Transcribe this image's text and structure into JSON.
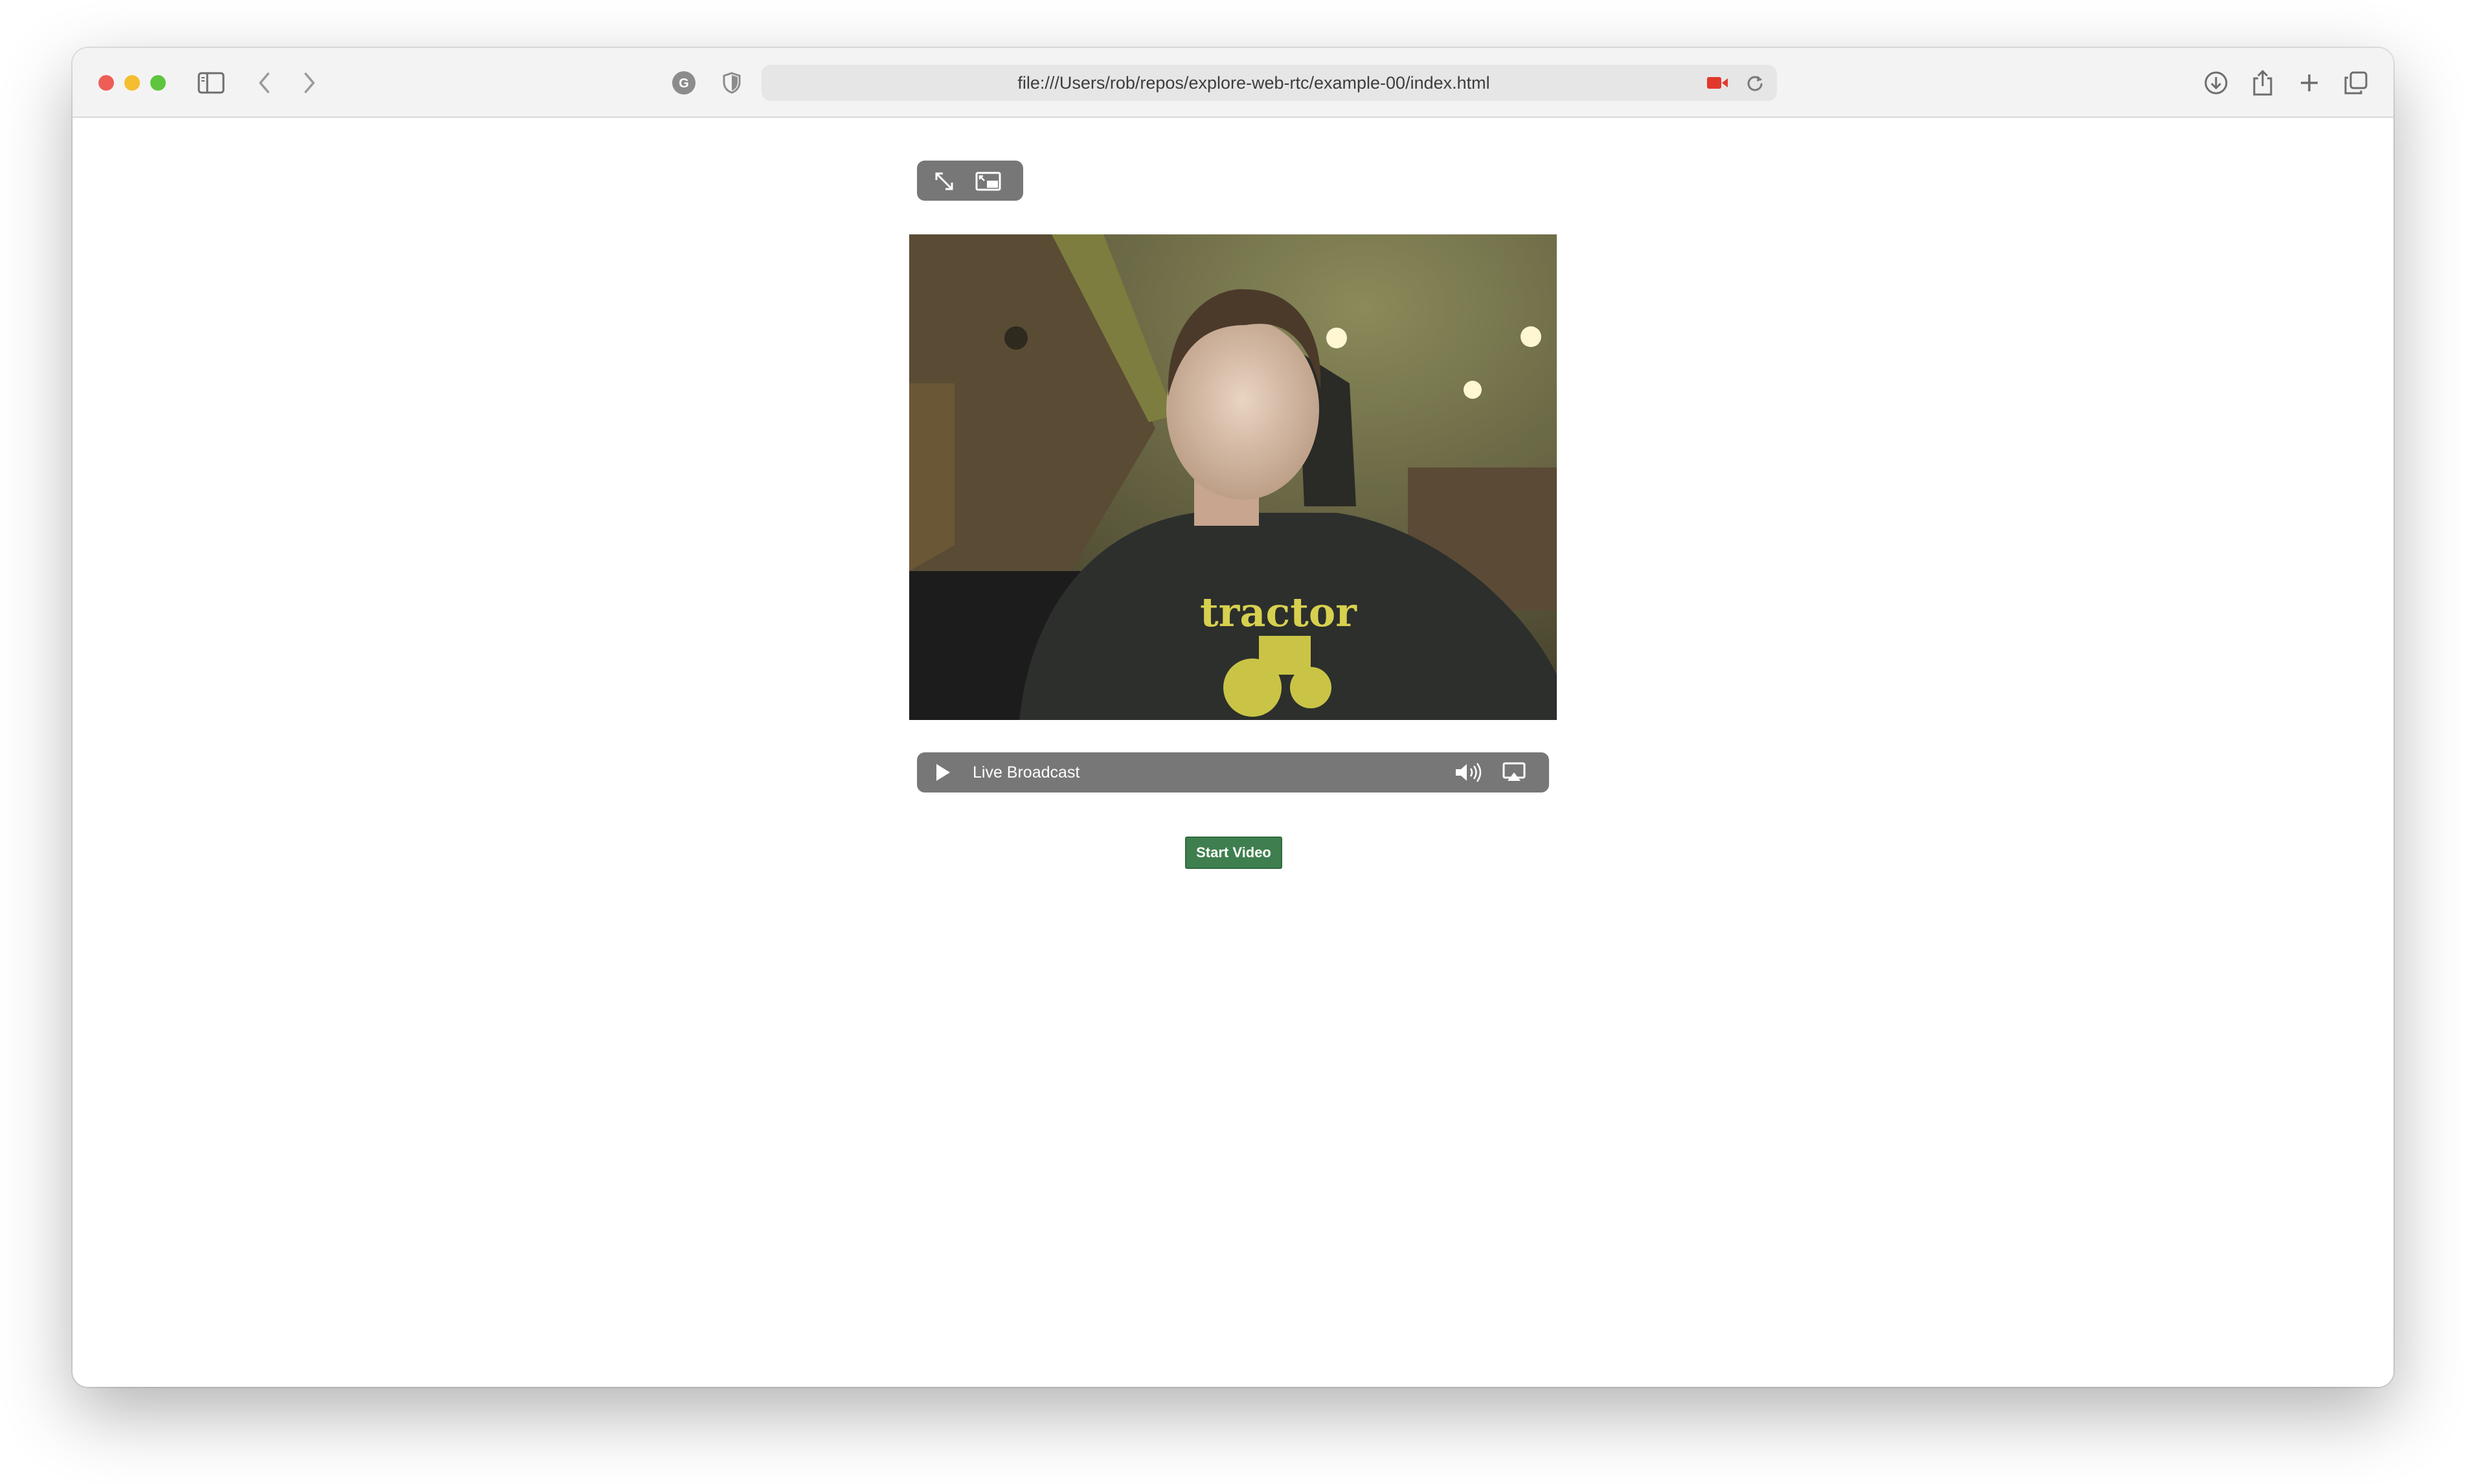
{
  "browser": {
    "url": "file:///Users/rob/repos/explore-web-rtc/example-00/index.html",
    "traffic_lights": {
      "close": "#ee5e57",
      "minimize": "#f5bd2f",
      "zoom": "#5fc53f"
    },
    "icons": [
      "sidebar-icon",
      "back-icon",
      "forward-icon",
      "extension-icon",
      "privacy-shield-icon",
      "camera-in-use-icon",
      "reload-icon",
      "downloads-icon",
      "share-icon",
      "new-tab-icon",
      "tab-overview-icon"
    ]
  },
  "player": {
    "status_label": "Live Broadcast",
    "top_controls": [
      "fullscreen-icon",
      "picture-in-picture-icon"
    ],
    "bottom_controls": [
      "play-icon",
      "volume-icon",
      "airplay-icon"
    ],
    "shirt_text": "tractor"
  },
  "page": {
    "start_button_label": "Start Video",
    "start_button_color": "#3f7e4e"
  }
}
